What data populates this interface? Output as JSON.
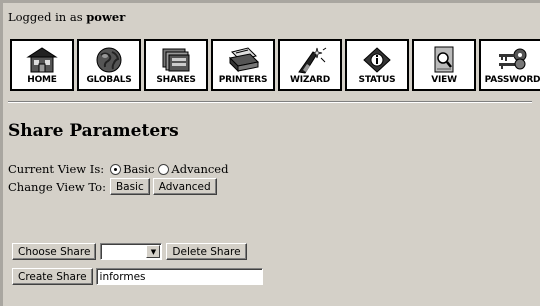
{
  "session": {
    "prefix": "Logged in as",
    "user": "power"
  },
  "nav": [
    {
      "label": "HOME",
      "icon": "house-icon"
    },
    {
      "label": "GLOBALS",
      "icon": "globe-icon"
    },
    {
      "label": "SHARES",
      "icon": "folder-share-icon"
    },
    {
      "label": "PRINTERS",
      "icon": "printer-icon"
    },
    {
      "label": "WIZARD",
      "icon": "wizard-wand-icon"
    },
    {
      "label": "STATUS",
      "icon": "status-icon"
    },
    {
      "label": "VIEW",
      "icon": "view-document-icon"
    },
    {
      "label": "PASSWORD",
      "icon": "key-icon"
    }
  ],
  "page": {
    "title": "Share Parameters"
  },
  "view": {
    "current_label": "Current View Is:",
    "options": [
      "Basic",
      "Advanced"
    ],
    "selected": "Basic",
    "change_label": "Change View To:",
    "basic_button": "Basic",
    "advanced_button": "Advanced"
  },
  "share": {
    "choose_button": "Choose Share",
    "selected": "",
    "delete_button": "Delete Share",
    "create_button": "Create Share",
    "new_name": "informes"
  }
}
